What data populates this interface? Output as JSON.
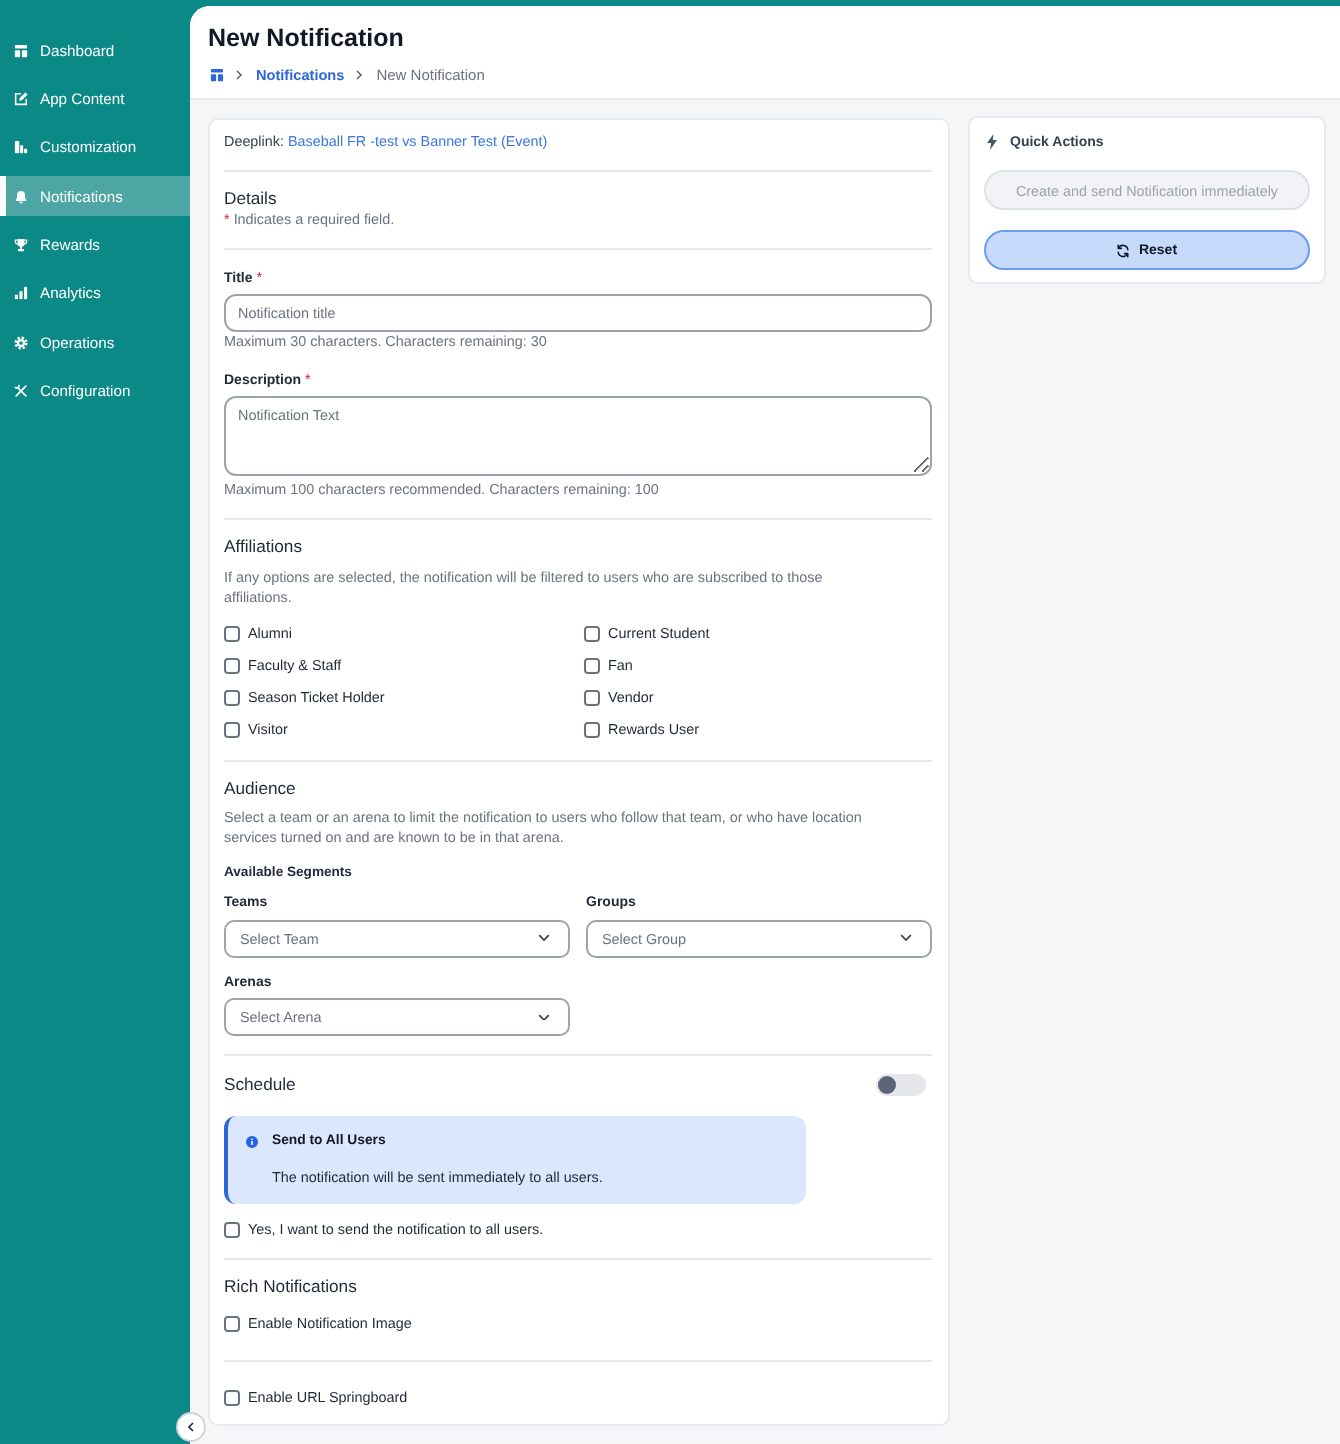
{
  "sidebar": {
    "items": [
      {
        "label": "Dashboard",
        "selected": false
      },
      {
        "label": "App Content",
        "selected": false
      },
      {
        "label": "Customization",
        "selected": false
      },
      {
        "label": "Notifications",
        "selected": true
      },
      {
        "label": "Rewards",
        "selected": false
      },
      {
        "label": "Analytics",
        "selected": false
      },
      {
        "label": "Operations",
        "selected": false
      },
      {
        "label": "Configuration",
        "selected": false
      }
    ]
  },
  "header": {
    "title": "New Notification",
    "breadcrumb": [
      {
        "label": "Notifications",
        "kind": "link"
      },
      {
        "label": "New Notification",
        "kind": "current"
      }
    ]
  },
  "form": {
    "deeplink": {
      "label": "Deeplink:",
      "value": "Baseball FR -test vs Banner Test (Event)"
    },
    "details": {
      "heading": "Details",
      "required_mark": "*",
      "required_note": "Indicates a required field."
    },
    "fields": [
      {
        "kind": "input",
        "label": "Title",
        "required_mark": "*",
        "placeholder": "Notification title",
        "hint": "Maximum 30 characters. Characters remaining: 30"
      },
      {
        "kind": "textarea",
        "label": "Description",
        "required_mark": "*",
        "placeholder": "Notification Text",
        "hint": "Maximum 100 characters recommended. Characters remaining: 100"
      }
    ],
    "affiliations": {
      "heading": "Affiliations",
      "description": "If any options are selected, the notification will be filtered to users who are subscribed to those affiliations.",
      "options": [
        {
          "label": "Alumni",
          "checked": false
        },
        {
          "label": "Current Student",
          "checked": false
        },
        {
          "label": "Faculty & Staff",
          "checked": false
        },
        {
          "label": "Fan",
          "checked": false
        },
        {
          "label": "Season Ticket Holder",
          "checked": false
        },
        {
          "label": "Vendor",
          "checked": false
        },
        {
          "label": "Visitor",
          "checked": false
        },
        {
          "label": "Rewards User",
          "checked": false
        }
      ]
    },
    "audience": {
      "heading": "Audience",
      "description": "Select a team or an arena to limit the notification to users who follow that team, or who have location services turned on and are known to be in that arena.",
      "segments_label": "Available Segments",
      "selects": [
        {
          "label": "Teams",
          "placeholder": "Select Team"
        },
        {
          "label": "Groups",
          "placeholder": "Select Group"
        },
        {
          "label": "Arenas",
          "placeholder": "Select Arena"
        }
      ]
    },
    "schedule": {
      "heading": "Schedule",
      "on": false,
      "alert": {
        "title": "Send to All Users",
        "message": "The notification will be sent immediately to all users."
      },
      "confirm": {
        "label": "Yes, I want to send the notification to all users.",
        "checked": false
      }
    },
    "rich_notifications": {
      "heading": "Rich Notifications",
      "options": [
        {
          "label": "Enable Notification Image",
          "checked": false
        }
      ]
    },
    "springboard": {
      "label": "Enable URL Springboard",
      "checked": false
    }
  },
  "quick_actions": {
    "title": "Quick Actions",
    "buttons": [
      {
        "kind": "send",
        "label": "Create and send Notification immediately",
        "disabled": true
      },
      {
        "kind": "reset",
        "label": "Reset",
        "disabled": false
      }
    ]
  }
}
